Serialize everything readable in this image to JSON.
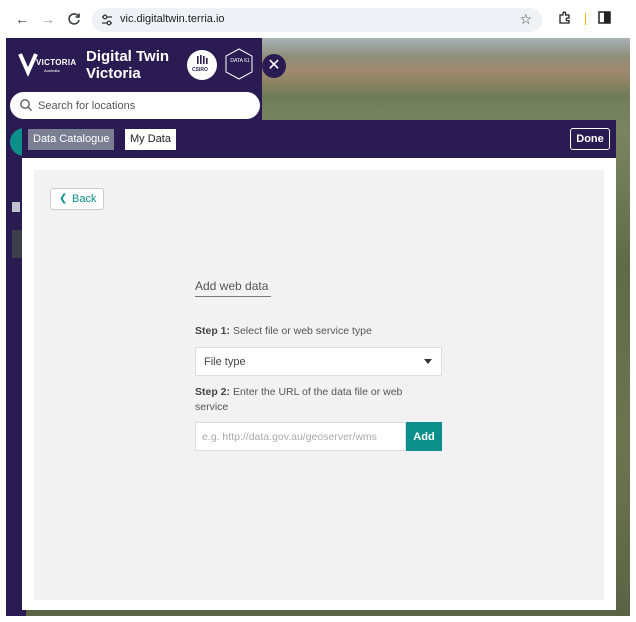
{
  "browser": {
    "url": "vic.digitaltwin.terria.io",
    "back_glyph": "←",
    "forward_glyph": "→",
    "reload_glyph": "↻",
    "star_glyph": "☆"
  },
  "brand": {
    "title_line1": "Digital Twin",
    "title_line2": "Victoria",
    "vic_logo_text": "VICTORIA",
    "vic_logo_sub": "Australia",
    "csiro_text": "CSIRO",
    "data61_text": "DATA 61",
    "close_glyph": "✕"
  },
  "search": {
    "placeholder": "Search for locations"
  },
  "modal": {
    "tabs": [
      {
        "label": "Data Catalogue",
        "active": true
      },
      {
        "label": "My Data",
        "active": false
      }
    ],
    "done_label": "Done",
    "back_label": "Back",
    "section_title": "Add web data",
    "step1_prefix": "Step 1:",
    "step1_text": "Select file or web service type",
    "file_type_value": "File type",
    "step2_prefix": "Step 2:",
    "step2_text_line1": "Enter the URL of the data file or web",
    "step2_text_line2": "service",
    "url_placeholder": "e.g. http://data.gov.au/geoserver/wms",
    "add_label": "Add"
  },
  "colors": {
    "navy": "#2a1c52",
    "teal": "#0b8f8b",
    "tab_active": "#7b7f93"
  }
}
